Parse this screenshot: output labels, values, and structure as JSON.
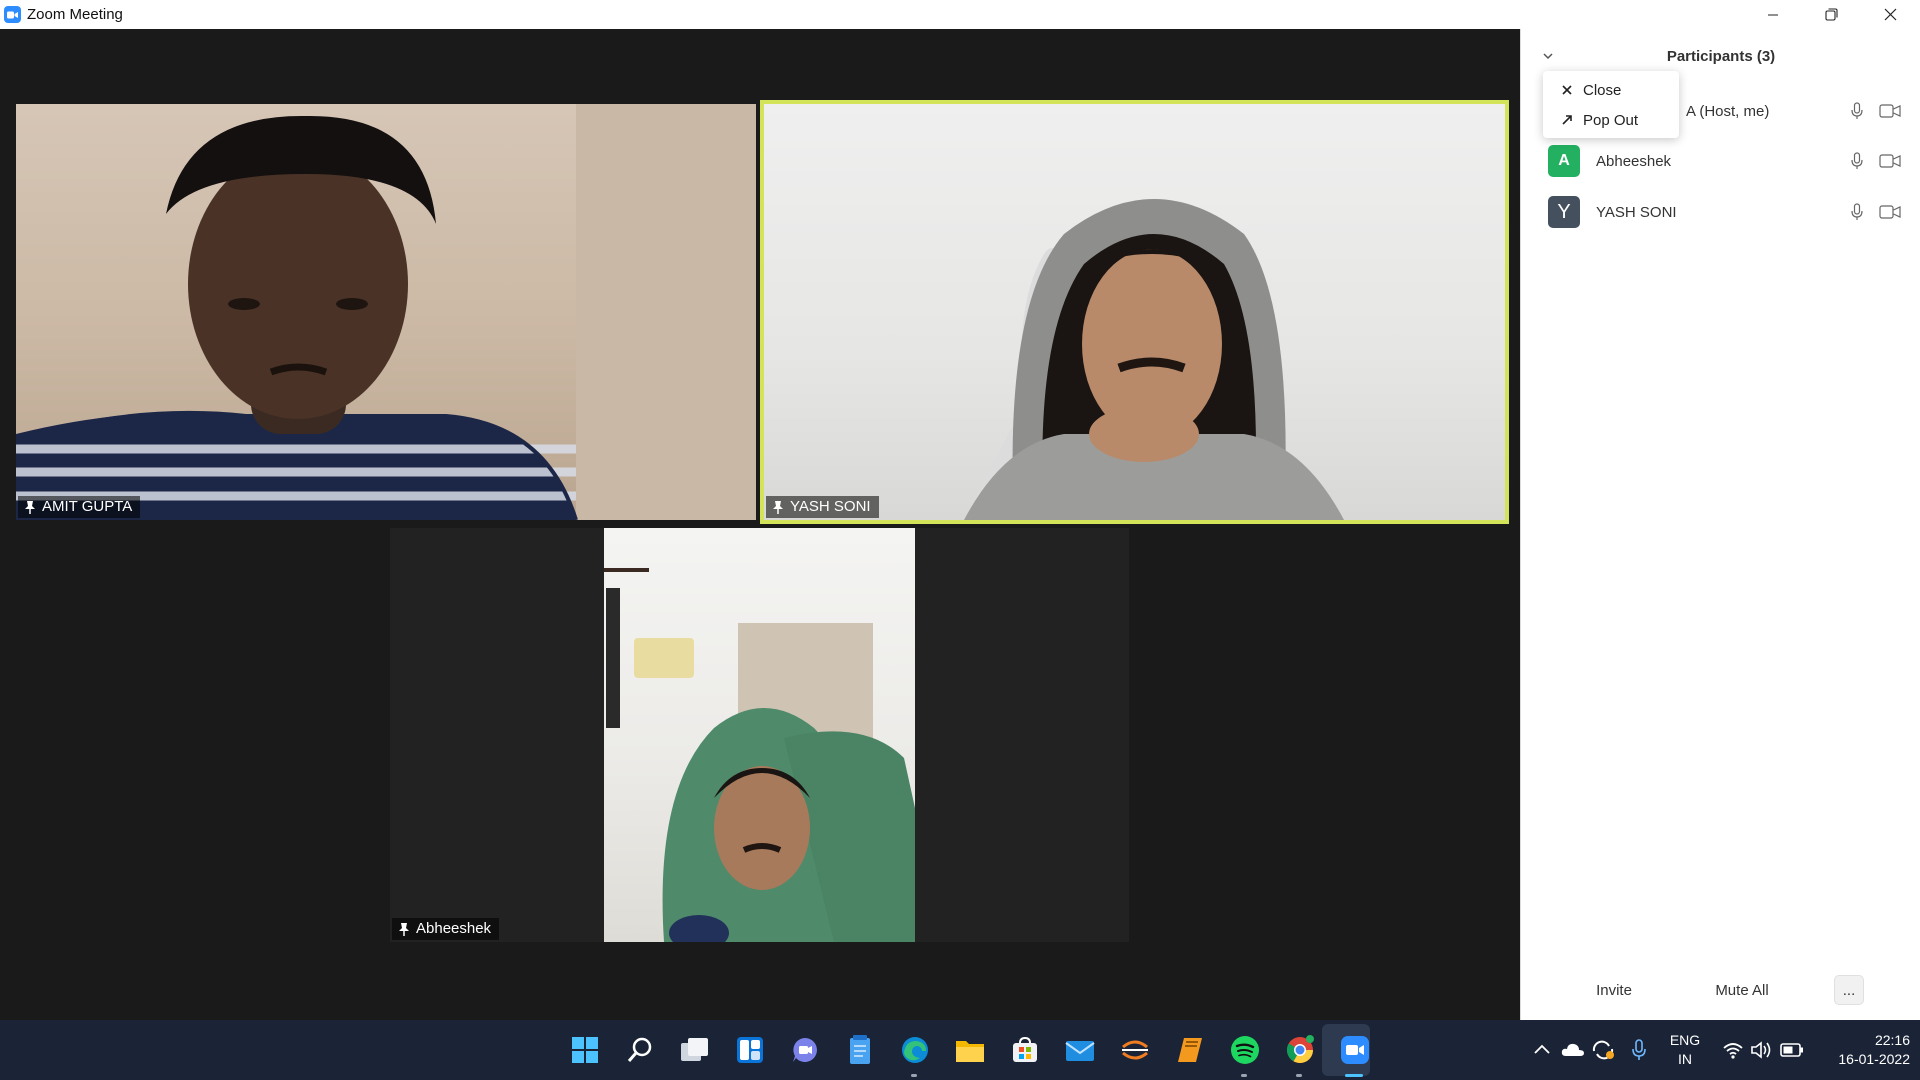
{
  "window": {
    "title": "Zoom Meeting",
    "icon": "zoom-app-icon",
    "controls": [
      "minimize-icon",
      "restore-icon",
      "close-icon"
    ]
  },
  "tiles": [
    {
      "name": "AMIT GUPTA",
      "icon": "pin-icon",
      "speaking": false
    },
    {
      "name": "YASH SONI",
      "icon": "pin-icon",
      "speaking": true,
      "highlight_color": "#d3e45a"
    },
    {
      "name": "Abheeshek",
      "icon": "pin-icon",
      "speaking": false
    }
  ],
  "panel": {
    "title": "Participants (3)",
    "collapse_icon": "chevron-down-icon",
    "context_menu": [
      {
        "icon": "close-icon",
        "label": "Close"
      },
      {
        "icon": "pop-out-icon",
        "label": "Pop Out"
      }
    ],
    "participants": [
      {
        "initial": "",
        "name": "A (Host, me)",
        "avatar_color": "#2d8cff",
        "mic_icon": "mic-icon",
        "cam_icon": "video-icon"
      },
      {
        "initial": "A",
        "name": "Abheeshek",
        "avatar_color": "#23b060",
        "mic_icon": "mic-icon",
        "cam_icon": "video-icon"
      },
      {
        "initial": "Y",
        "name": "YASH SONI",
        "avatar_color": "#45505e",
        "mic_icon": "mic-icon",
        "cam_icon": "video-icon"
      }
    ],
    "footer": {
      "invite": "Invite",
      "mute_all": "Mute All",
      "more": "..."
    }
  },
  "taskbar": {
    "apps": [
      "windows-start-icon",
      "search-icon",
      "task-view-icon",
      "widgets-icon",
      "teams-chat-icon",
      "notepad-icon",
      "edge-icon",
      "file-explorer-icon",
      "store-icon",
      "mail-icon",
      "app-orange-icon",
      "books-icon",
      "spotify-icon",
      "chrome-icon",
      "zoom-icon"
    ],
    "tray": {
      "lang_line1": "ENG",
      "lang_line2": "IN",
      "time": "22:16",
      "date": "16-01-2022"
    }
  },
  "colors": {
    "meeting_bg": "#1a1a1a",
    "taskbar_bg": "#1b2436",
    "accent": "#2d8cff",
    "speaker_border": "#d3e45a"
  }
}
